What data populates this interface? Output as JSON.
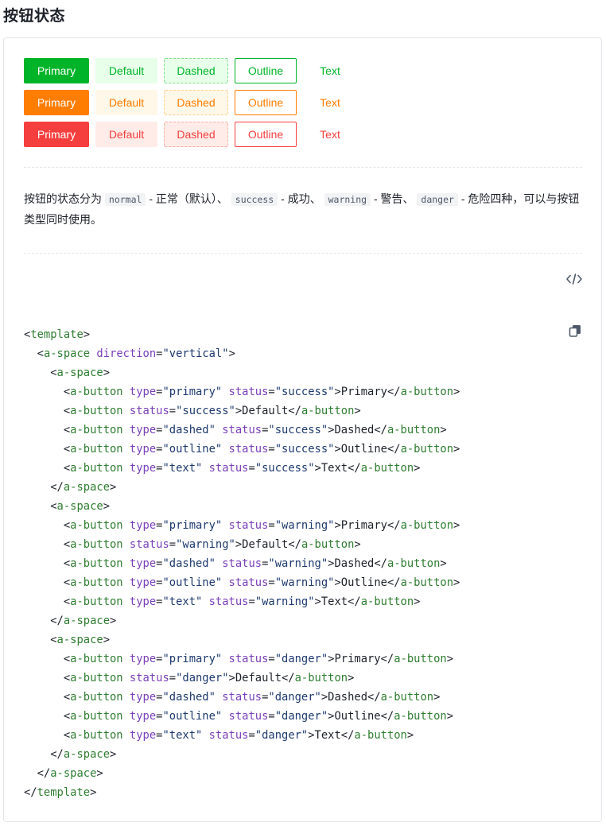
{
  "page_title": "按钮状态",
  "colors": {
    "success": "#00b42a",
    "success_light": "#e8ffea",
    "success_border": "#7be188",
    "warning": "#ff7d00",
    "warning_light": "#fff7e8",
    "warning_border": "#ffcf8b",
    "danger": "#f53f3f",
    "danger_light": "#ffece8",
    "danger_border": "#fbaca3"
  },
  "button_rows": [
    {
      "status": "success",
      "primary": "Primary",
      "default": "Default",
      "dashed": "Dashed",
      "outline": "Outline",
      "text": "Text"
    },
    {
      "status": "warning",
      "primary": "Primary",
      "default": "Default",
      "dashed": "Dashed",
      "outline": "Outline",
      "text": "Text"
    },
    {
      "status": "danger",
      "primary": "Primary",
      "default": "Default",
      "dashed": "Dashed",
      "outline": "Outline",
      "text": "Text"
    }
  ],
  "description": {
    "p1": "按钮的状态分为",
    "c1": "normal",
    "p2": "- 正常（默认）、",
    "c2": "success",
    "p3": "- 成功、",
    "c3": "warning",
    "p4": "- 警告、",
    "c4": "danger",
    "p5": "- 危险四种，可以与按钮类型同时使用。"
  },
  "icons": {
    "code_toggle": "code-icon",
    "copy": "copy-icon"
  },
  "code_lines": [
    [
      [
        "p",
        "<"
      ],
      [
        "t",
        "template"
      ],
      [
        "p",
        ">"
      ]
    ],
    [
      [
        "x",
        "  "
      ],
      [
        "p",
        "<"
      ],
      [
        "t",
        "a-space"
      ],
      [
        "x",
        " "
      ],
      [
        "a",
        "direction"
      ],
      [
        "p",
        "="
      ],
      [
        "s",
        "\"vertical\""
      ],
      [
        "p",
        ">"
      ]
    ],
    [
      [
        "x",
        "    "
      ],
      [
        "p",
        "<"
      ],
      [
        "t",
        "a-space"
      ],
      [
        "p",
        ">"
      ]
    ],
    [
      [
        "x",
        "      "
      ],
      [
        "p",
        "<"
      ],
      [
        "t",
        "a-button"
      ],
      [
        "x",
        " "
      ],
      [
        "a",
        "type"
      ],
      [
        "p",
        "="
      ],
      [
        "s",
        "\"primary\""
      ],
      [
        "x",
        " "
      ],
      [
        "a",
        "status"
      ],
      [
        "p",
        "="
      ],
      [
        "s",
        "\"success\""
      ],
      [
        "p",
        ">"
      ],
      [
        "x",
        "Primary"
      ],
      [
        "p",
        "</"
      ],
      [
        "t",
        "a-button"
      ],
      [
        "p",
        ">"
      ]
    ],
    [
      [
        "x",
        "      "
      ],
      [
        "p",
        "<"
      ],
      [
        "t",
        "a-button"
      ],
      [
        "x",
        " "
      ],
      [
        "a",
        "status"
      ],
      [
        "p",
        "="
      ],
      [
        "s",
        "\"success\""
      ],
      [
        "p",
        ">"
      ],
      [
        "x",
        "Default"
      ],
      [
        "p",
        "</"
      ],
      [
        "t",
        "a-button"
      ],
      [
        "p",
        ">"
      ]
    ],
    [
      [
        "x",
        "      "
      ],
      [
        "p",
        "<"
      ],
      [
        "t",
        "a-button"
      ],
      [
        "x",
        " "
      ],
      [
        "a",
        "type"
      ],
      [
        "p",
        "="
      ],
      [
        "s",
        "\"dashed\""
      ],
      [
        "x",
        " "
      ],
      [
        "a",
        "status"
      ],
      [
        "p",
        "="
      ],
      [
        "s",
        "\"success\""
      ],
      [
        "p",
        ">"
      ],
      [
        "x",
        "Dashed"
      ],
      [
        "p",
        "</"
      ],
      [
        "t",
        "a-button"
      ],
      [
        "p",
        ">"
      ]
    ],
    [
      [
        "x",
        "      "
      ],
      [
        "p",
        "<"
      ],
      [
        "t",
        "a-button"
      ],
      [
        "x",
        " "
      ],
      [
        "a",
        "type"
      ],
      [
        "p",
        "="
      ],
      [
        "s",
        "\"outline\""
      ],
      [
        "x",
        " "
      ],
      [
        "a",
        "status"
      ],
      [
        "p",
        "="
      ],
      [
        "s",
        "\"success\""
      ],
      [
        "p",
        ">"
      ],
      [
        "x",
        "Outline"
      ],
      [
        "p",
        "</"
      ],
      [
        "t",
        "a-button"
      ],
      [
        "p",
        ">"
      ]
    ],
    [
      [
        "x",
        "      "
      ],
      [
        "p",
        "<"
      ],
      [
        "t",
        "a-button"
      ],
      [
        "x",
        " "
      ],
      [
        "a",
        "type"
      ],
      [
        "p",
        "="
      ],
      [
        "s",
        "\"text\""
      ],
      [
        "x",
        " "
      ],
      [
        "a",
        "status"
      ],
      [
        "p",
        "="
      ],
      [
        "s",
        "\"success\""
      ],
      [
        "p",
        ">"
      ],
      [
        "x",
        "Text"
      ],
      [
        "p",
        "</"
      ],
      [
        "t",
        "a-button"
      ],
      [
        "p",
        ">"
      ]
    ],
    [
      [
        "x",
        "    "
      ],
      [
        "p",
        "</"
      ],
      [
        "t",
        "a-space"
      ],
      [
        "p",
        ">"
      ]
    ],
    [
      [
        "x",
        "    "
      ],
      [
        "p",
        "<"
      ],
      [
        "t",
        "a-space"
      ],
      [
        "p",
        ">"
      ]
    ],
    [
      [
        "x",
        "      "
      ],
      [
        "p",
        "<"
      ],
      [
        "t",
        "a-button"
      ],
      [
        "x",
        " "
      ],
      [
        "a",
        "type"
      ],
      [
        "p",
        "="
      ],
      [
        "s",
        "\"primary\""
      ],
      [
        "x",
        " "
      ],
      [
        "a",
        "status"
      ],
      [
        "p",
        "="
      ],
      [
        "s",
        "\"warning\""
      ],
      [
        "p",
        ">"
      ],
      [
        "x",
        "Primary"
      ],
      [
        "p",
        "</"
      ],
      [
        "t",
        "a-button"
      ],
      [
        "p",
        ">"
      ]
    ],
    [
      [
        "x",
        "      "
      ],
      [
        "p",
        "<"
      ],
      [
        "t",
        "a-button"
      ],
      [
        "x",
        " "
      ],
      [
        "a",
        "status"
      ],
      [
        "p",
        "="
      ],
      [
        "s",
        "\"warning\""
      ],
      [
        "p",
        ">"
      ],
      [
        "x",
        "Default"
      ],
      [
        "p",
        "</"
      ],
      [
        "t",
        "a-button"
      ],
      [
        "p",
        ">"
      ]
    ],
    [
      [
        "x",
        "      "
      ],
      [
        "p",
        "<"
      ],
      [
        "t",
        "a-button"
      ],
      [
        "x",
        " "
      ],
      [
        "a",
        "type"
      ],
      [
        "p",
        "="
      ],
      [
        "s",
        "\"dashed\""
      ],
      [
        "x",
        " "
      ],
      [
        "a",
        "status"
      ],
      [
        "p",
        "="
      ],
      [
        "s",
        "\"warning\""
      ],
      [
        "p",
        ">"
      ],
      [
        "x",
        "Dashed"
      ],
      [
        "p",
        "</"
      ],
      [
        "t",
        "a-button"
      ],
      [
        "p",
        ">"
      ]
    ],
    [
      [
        "x",
        "      "
      ],
      [
        "p",
        "<"
      ],
      [
        "t",
        "a-button"
      ],
      [
        "x",
        " "
      ],
      [
        "a",
        "type"
      ],
      [
        "p",
        "="
      ],
      [
        "s",
        "\"outline\""
      ],
      [
        "x",
        " "
      ],
      [
        "a",
        "status"
      ],
      [
        "p",
        "="
      ],
      [
        "s",
        "\"warning\""
      ],
      [
        "p",
        ">"
      ],
      [
        "x",
        "Outline"
      ],
      [
        "p",
        "</"
      ],
      [
        "t",
        "a-button"
      ],
      [
        "p",
        ">"
      ]
    ],
    [
      [
        "x",
        "      "
      ],
      [
        "p",
        "<"
      ],
      [
        "t",
        "a-button"
      ],
      [
        "x",
        " "
      ],
      [
        "a",
        "type"
      ],
      [
        "p",
        "="
      ],
      [
        "s",
        "\"text\""
      ],
      [
        "x",
        " "
      ],
      [
        "a",
        "status"
      ],
      [
        "p",
        "="
      ],
      [
        "s",
        "\"warning\""
      ],
      [
        "p",
        ">"
      ],
      [
        "x",
        "Text"
      ],
      [
        "p",
        "</"
      ],
      [
        "t",
        "a-button"
      ],
      [
        "p",
        ">"
      ]
    ],
    [
      [
        "x",
        "    "
      ],
      [
        "p",
        "</"
      ],
      [
        "t",
        "a-space"
      ],
      [
        "p",
        ">"
      ]
    ],
    [
      [
        "x",
        "    "
      ],
      [
        "p",
        "<"
      ],
      [
        "t",
        "a-space"
      ],
      [
        "p",
        ">"
      ]
    ],
    [
      [
        "x",
        "      "
      ],
      [
        "p",
        "<"
      ],
      [
        "t",
        "a-button"
      ],
      [
        "x",
        " "
      ],
      [
        "a",
        "type"
      ],
      [
        "p",
        "="
      ],
      [
        "s",
        "\"primary\""
      ],
      [
        "x",
        " "
      ],
      [
        "a",
        "status"
      ],
      [
        "p",
        "="
      ],
      [
        "s",
        "\"danger\""
      ],
      [
        "p",
        ">"
      ],
      [
        "x",
        "Primary"
      ],
      [
        "p",
        "</"
      ],
      [
        "t",
        "a-button"
      ],
      [
        "p",
        ">"
      ]
    ],
    [
      [
        "x",
        "      "
      ],
      [
        "p",
        "<"
      ],
      [
        "t",
        "a-button"
      ],
      [
        "x",
        " "
      ],
      [
        "a",
        "status"
      ],
      [
        "p",
        "="
      ],
      [
        "s",
        "\"danger\""
      ],
      [
        "p",
        ">"
      ],
      [
        "x",
        "Default"
      ],
      [
        "p",
        "</"
      ],
      [
        "t",
        "a-button"
      ],
      [
        "p",
        ">"
      ]
    ],
    [
      [
        "x",
        "      "
      ],
      [
        "p",
        "<"
      ],
      [
        "t",
        "a-button"
      ],
      [
        "x",
        " "
      ],
      [
        "a",
        "type"
      ],
      [
        "p",
        "="
      ],
      [
        "s",
        "\"dashed\""
      ],
      [
        "x",
        " "
      ],
      [
        "a",
        "status"
      ],
      [
        "p",
        "="
      ],
      [
        "s",
        "\"danger\""
      ],
      [
        "p",
        ">"
      ],
      [
        "x",
        "Dashed"
      ],
      [
        "p",
        "</"
      ],
      [
        "t",
        "a-button"
      ],
      [
        "p",
        ">"
      ]
    ],
    [
      [
        "x",
        "      "
      ],
      [
        "p",
        "<"
      ],
      [
        "t",
        "a-button"
      ],
      [
        "x",
        " "
      ],
      [
        "a",
        "type"
      ],
      [
        "p",
        "="
      ],
      [
        "s",
        "\"outline\""
      ],
      [
        "x",
        " "
      ],
      [
        "a",
        "status"
      ],
      [
        "p",
        "="
      ],
      [
        "s",
        "\"danger\""
      ],
      [
        "p",
        ">"
      ],
      [
        "x",
        "Outline"
      ],
      [
        "p",
        "</"
      ],
      [
        "t",
        "a-button"
      ],
      [
        "p",
        ">"
      ]
    ],
    [
      [
        "x",
        "      "
      ],
      [
        "p",
        "<"
      ],
      [
        "t",
        "a-button"
      ],
      [
        "x",
        " "
      ],
      [
        "a",
        "type"
      ],
      [
        "p",
        "="
      ],
      [
        "s",
        "\"text\""
      ],
      [
        "x",
        " "
      ],
      [
        "a",
        "status"
      ],
      [
        "p",
        "="
      ],
      [
        "s",
        "\"danger\""
      ],
      [
        "p",
        ">"
      ],
      [
        "x",
        "Text"
      ],
      [
        "p",
        "</"
      ],
      [
        "t",
        "a-button"
      ],
      [
        "p",
        ">"
      ]
    ],
    [
      [
        "x",
        "    "
      ],
      [
        "p",
        "</"
      ],
      [
        "t",
        "a-space"
      ],
      [
        "p",
        ">"
      ]
    ],
    [
      [
        "x",
        "  "
      ],
      [
        "p",
        "</"
      ],
      [
        "t",
        "a-space"
      ],
      [
        "p",
        ">"
      ]
    ],
    [
      [
        "p",
        "</"
      ],
      [
        "t",
        "template"
      ],
      [
        "p",
        ">"
      ]
    ]
  ]
}
